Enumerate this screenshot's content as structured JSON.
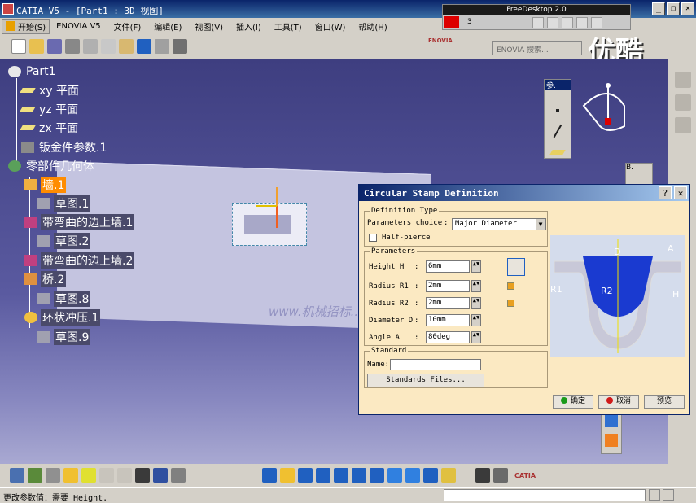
{
  "window": {
    "title": "CATIA V5 - [Part1 : 3D 视图]",
    "min_glyph": "_",
    "restore_glyph": "❐",
    "close_glyph": "✕"
  },
  "freedesktop": {
    "title": "FreeDesktop 2.0",
    "number": "3"
  },
  "watermark_brand": "优酷",
  "menubar": {
    "items": [
      "开始(S)",
      "ENOVIA V5",
      "文件(F)",
      "编辑(E)",
      "视图(V)",
      "插入(I)",
      "工具(T)",
      "窗口(W)",
      "帮助(H)"
    ]
  },
  "toolbar": {
    "enovia_logo": "ENOVIA",
    "enovia_search_placeholder": "ENOVIA 搜索..."
  },
  "tree": {
    "root": "Part1",
    "items": [
      {
        "label": "xy 平面",
        "icon": "plane-icon"
      },
      {
        "label": "yz 平面",
        "icon": "plane-icon"
      },
      {
        "label": "zx 平面",
        "icon": "plane-icon"
      },
      {
        "label": "钣金件参数.1",
        "icon": "sheetmetal-params-icon"
      },
      {
        "label": "零部件几何体",
        "icon": "part-body-icon"
      },
      {
        "label": "墙.1",
        "icon": "wall-icon",
        "selected": true
      },
      {
        "label": "草图.1",
        "icon": "sketch-icon"
      },
      {
        "label": "带弯曲的边上墙.1",
        "icon": "flange-icon"
      },
      {
        "label": "草图.2",
        "icon": "sketch-icon"
      },
      {
        "label": "带弯曲的边上墙.2",
        "icon": "flange-icon"
      },
      {
        "label": "桥.2",
        "icon": "bridge-icon"
      },
      {
        "label": "草图.8",
        "icon": "sketch-icon"
      },
      {
        "label": "环状冲压.1",
        "icon": "stamp-icon"
      },
      {
        "label": "草图.9",
        "icon": "sketch-icon"
      }
    ]
  },
  "mini_panel": {
    "title": "参."
  },
  "b_panel": {
    "title": "B."
  },
  "watermark_site": "www.机械招标...",
  "dialog": {
    "title": "Circular Stamp Definition",
    "help_glyph": "?",
    "close_glyph": "✕",
    "definition_type": {
      "legend": "Definition Type",
      "parameters_choice_label": "Parameters choice",
      "parameters_choice_value": "Major Diameter",
      "half_pierce_label": "Half-pierce"
    },
    "parameters": {
      "legend": "Parameters",
      "rows": [
        {
          "label": "Height H",
          "value": "6mm"
        },
        {
          "label": "Radius R1",
          "value": "2mm"
        },
        {
          "label": "Radius R2",
          "value": "2mm"
        },
        {
          "label": "Diameter D",
          "value": "10mm"
        },
        {
          "label": "Angle A",
          "value": "80deg"
        }
      ],
      "colon": ":"
    },
    "standard": {
      "legend": "Standard",
      "name_label": "Name:",
      "name_value": "",
      "standards_files_button": "Standards Files..."
    },
    "buttons": {
      "ok": "确定",
      "cancel": "取消",
      "preview": "预览"
    },
    "preview_labels": {
      "D": "D",
      "A": "A",
      "R1": "R1",
      "R2": "R2",
      "H": "H"
    }
  },
  "statusbar": {
    "text": "更改参数值：需要 Height."
  },
  "bottom_logo": "CATIA",
  "colors": {
    "selected": "#ff8c00",
    "title_bar": "#0a246a",
    "dialog_bg": "#fbe9c2",
    "ok_dot": "#1a9a1a",
    "cancel_dot": "#d01a1a"
  }
}
